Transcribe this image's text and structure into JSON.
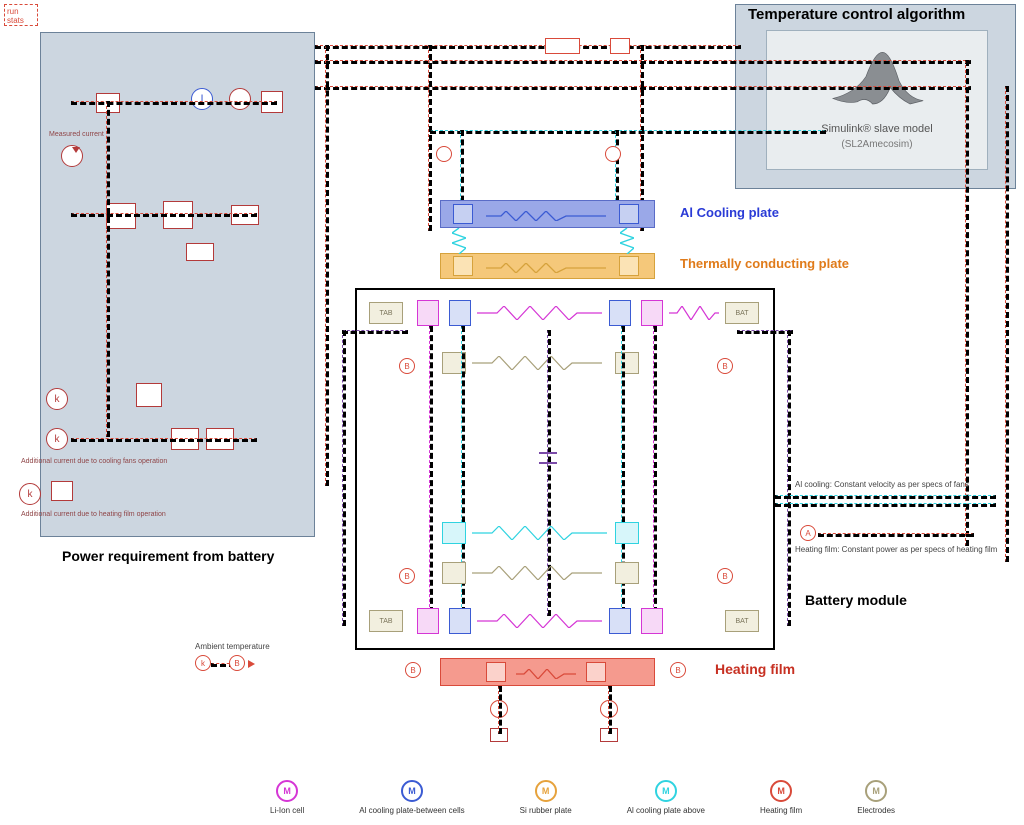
{
  "titles": {
    "temp_control": "Temperature control algorithm",
    "simulink_main": "Simulink® slave model",
    "simulink_sub": "(SL2Amecosim)",
    "power_req": "Power requirement from battery",
    "al_cooling": "Al Cooling plate",
    "therm_conduct": "Thermally conducting plate",
    "battery_module": "Battery module",
    "heating_film": "Heating film",
    "run_stats": "run\nstats",
    "ambient_temp": "Ambient temperature"
  },
  "annotations": {
    "measured_current": "Measured current",
    "add_current_cooling": "Additional current due to cooling fans operation",
    "add_current_heating": "Additional current due to heating film operation",
    "al_cooling_note": "Al cooling: Constant velocity as per specs of fans",
    "heating_film_note": "Heating film: Constant power as per specs of heating film",
    "tab": "TAB",
    "bat": "BAT"
  },
  "legend": [
    {
      "label": "Li-Ion cell",
      "color": "#d536d5"
    },
    {
      "label": "Al cooling plate-between cells",
      "color": "#3b5bd3"
    },
    {
      "label": "Si rubber plate",
      "color": "#e6a23c"
    },
    {
      "label": "Al cooling plate above",
      "color": "#2fd3e0"
    },
    {
      "label": "Heating film",
      "color": "#d94a3a"
    },
    {
      "label": "Electrodes",
      "color": "#a8a07a"
    }
  ],
  "legend_glyph": "M",
  "colors": {
    "panel_blue": "#a3b5c7",
    "panel_blue_border": "#6c8299",
    "wire_red": "#d94a3a",
    "wire_purple": "#7a4aa8",
    "wire_cyan": "#2fd3e0",
    "wire_magenta": "#d536d5",
    "wire_olive": "#a8a07a",
    "al_fill": "#9aa8e8",
    "therm_fill": "#f5c87a",
    "heat_fill": "#f59a8e",
    "black": "#000"
  }
}
